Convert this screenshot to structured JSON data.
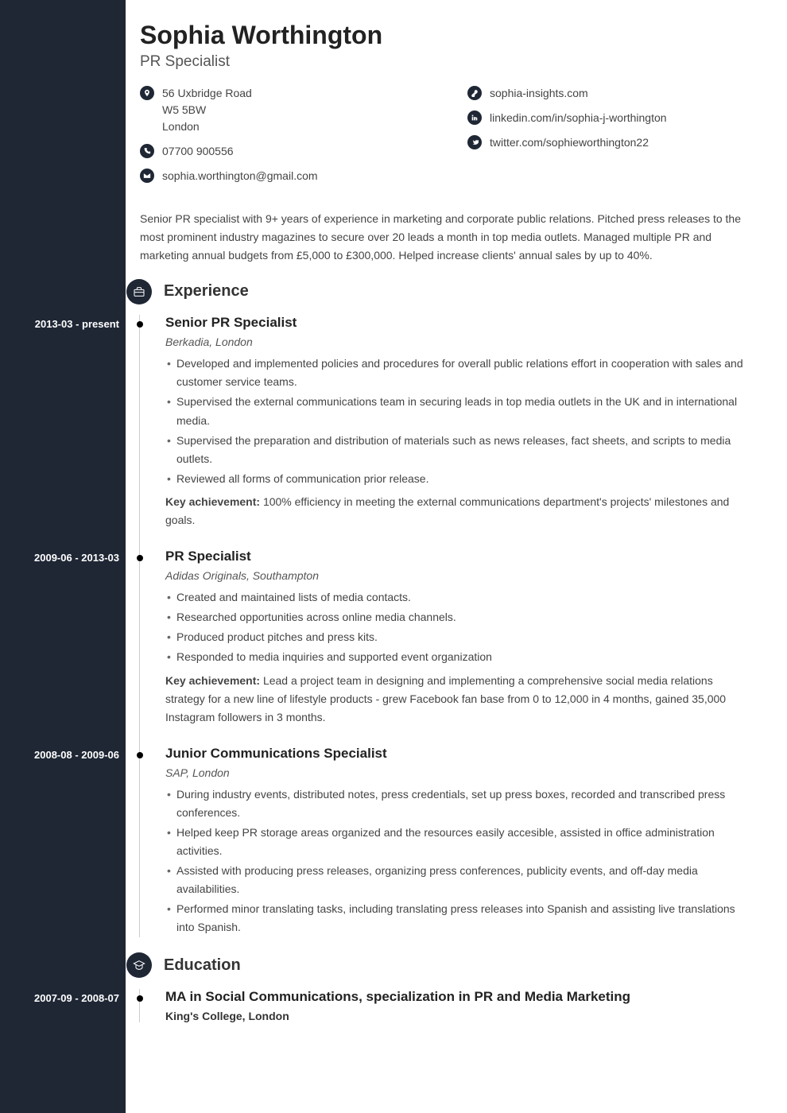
{
  "header": {
    "name": "Sophia Worthington",
    "title": "PR Specialist"
  },
  "contact": {
    "left": [
      {
        "icon": "location",
        "lines": [
          "56 Uxbridge Road",
          "W5 5BW",
          "London"
        ]
      },
      {
        "icon": "phone",
        "lines": [
          "07700 900556"
        ]
      },
      {
        "icon": "mail",
        "lines": [
          "sophia.worthington@gmail.com"
        ]
      }
    ],
    "right": [
      {
        "icon": "link",
        "lines": [
          "sophia-insights.com"
        ]
      },
      {
        "icon": "linkedin",
        "lines": [
          "linkedin.com/in/sophia-j-worthington"
        ]
      },
      {
        "icon": "twitter",
        "lines": [
          "twitter.com/sophieworthington22"
        ]
      }
    ]
  },
  "summary": "Senior PR specialist with 9+ years of experience in marketing and corporate public relations. Pitched press releases to the most prominent industry magazines to secure over 20 leads a month in top media outlets. Managed multiple PR and marketing annual budgets from £5,000 to £300,000. Helped increase clients' annual sales by up to 40%.",
  "sections": {
    "experience": "Experience",
    "education": "Education"
  },
  "experience": [
    {
      "dates": "2013-03 - present",
      "title": "Senior PR Specialist",
      "meta": "Berkadia, London",
      "bullets": [
        "Developed and implemented policies and procedures for overall public relations effort in cooperation with sales and customer service teams.",
        "Supervised the external communications team in securing leads in top media outlets in the UK and in international media.",
        "Supervised the preparation and distribution of materials such as news releases, fact sheets, and scripts to media outlets.",
        "Reviewed all forms of communication prior release."
      ],
      "achievement_label": "Key achievement:",
      "achievement": " 100% efficiency in meeting the external communications department's projects' milestones and goals."
    },
    {
      "dates": "2009-06 - 2013-03",
      "title": "PR Specialist",
      "meta": "Adidas Originals, Southampton",
      "bullets": [
        "Created and maintained lists of media contacts.",
        "Researched opportunities across online media channels.",
        "Produced product pitches and press kits.",
        "Responded to media inquiries and supported event organization"
      ],
      "achievement_label": "Key achievement:",
      "achievement": " Lead a project team in designing and implementing a comprehensive social media relations strategy for a new line of lifestyle products - grew Facebook fan base from 0 to 12,000 in 4 months, gained 35,000 Instagram followers in 3 months."
    },
    {
      "dates": "2008-08 - 2009-06",
      "title": "Junior Communications Specialist",
      "meta": "SAP, London",
      "bullets": [
        "During industry events, distributed notes, press credentials, set up press boxes, recorded and transcribed press conferences.",
        "Helped keep PR storage areas organized and the resources easily accesible, assisted in office administration activities.",
        "Assisted with producing press releases, organizing press conferences, publicity events, and off-day media availabilities.",
        "Performed minor translating tasks, including translating press releases into Spanish and assisting live translations into Spanish."
      ]
    }
  ],
  "education": [
    {
      "dates": "2007-09 - 2008-07",
      "title": "MA in Social Communications, specialization in PR and Media Marketing",
      "school": "King's College, London"
    }
  ]
}
